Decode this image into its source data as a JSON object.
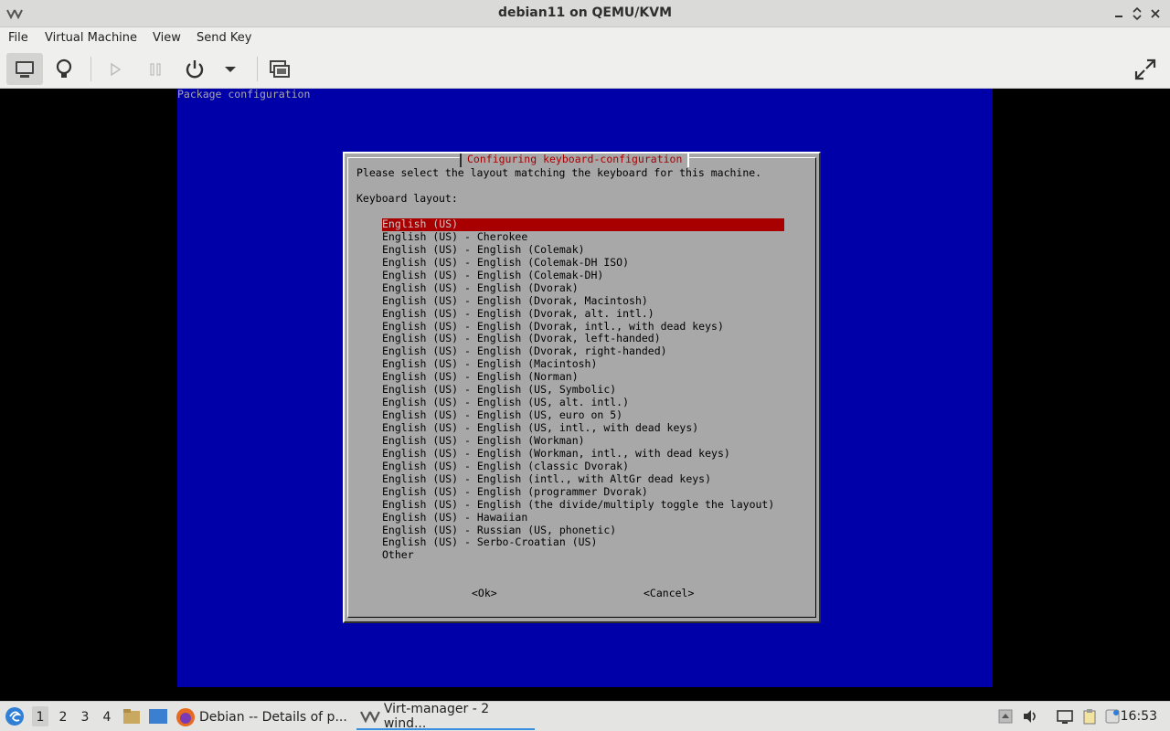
{
  "window": {
    "title": "debian11 on QEMU/KVM"
  },
  "menubar": {
    "items": [
      "File",
      "Virtual Machine",
      "View",
      "Send Key"
    ]
  },
  "toolbar": {
    "icons": [
      "monitor-icon",
      "lightbulb-icon",
      "play-icon",
      "pause-icon",
      "power-icon",
      "dropdown-arrow-icon",
      "snapshots-icon",
      "fullscreen-icon"
    ]
  },
  "vm": {
    "header": "Package configuration",
    "dialog": {
      "title": "Configuring keyboard-configuration",
      "prompt": "Please select the layout matching the keyboard for this machine.",
      "list_label": "Keyboard layout:",
      "selected_index": 0,
      "options": [
        "English (US)",
        "English (US) - Cherokee",
        "English (US) - English (Colemak)",
        "English (US) - English (Colemak-DH ISO)",
        "English (US) - English (Colemak-DH)",
        "English (US) - English (Dvorak)",
        "English (US) - English (Dvorak, Macintosh)",
        "English (US) - English (Dvorak, alt. intl.)",
        "English (US) - English (Dvorak, intl., with dead keys)",
        "English (US) - English (Dvorak, left-handed)",
        "English (US) - English (Dvorak, right-handed)",
        "English (US) - English (Macintosh)",
        "English (US) - English (Norman)",
        "English (US) - English (US, Symbolic)",
        "English (US) - English (US, alt. intl.)",
        "English (US) - English (US, euro on 5)",
        "English (US) - English (US, intl., with dead keys)",
        "English (US) - English (Workman)",
        "English (US) - English (Workman, intl., with dead keys)",
        "English (US) - English (classic Dvorak)",
        "English (US) - English (intl., with AltGr dead keys)",
        "English (US) - English (programmer Dvorak)",
        "English (US) - English (the divide/multiply toggle the layout)",
        "English (US) - Hawaiian",
        "English (US) - Russian (US, phonetic)",
        "English (US) - Serbo-Croatian (US)",
        "Other"
      ],
      "ok_label": "<Ok>",
      "cancel_label": "<Cancel>"
    }
  },
  "taskbar": {
    "workspaces": [
      "1",
      "2",
      "3",
      "4"
    ],
    "active_workspace": "1",
    "tasks": [
      {
        "label": "Debian -- Details of p...",
        "icon": "firefox-icon"
      },
      {
        "label": "Virt-manager - 2 wind...",
        "icon": "virt-manager-icon"
      }
    ],
    "clock": "16:53"
  },
  "colors": {
    "vm_background": "#0000a8",
    "dialog_background": "#a8a8a8",
    "selection": "#a80000",
    "dialog_title": "#a80000"
  }
}
